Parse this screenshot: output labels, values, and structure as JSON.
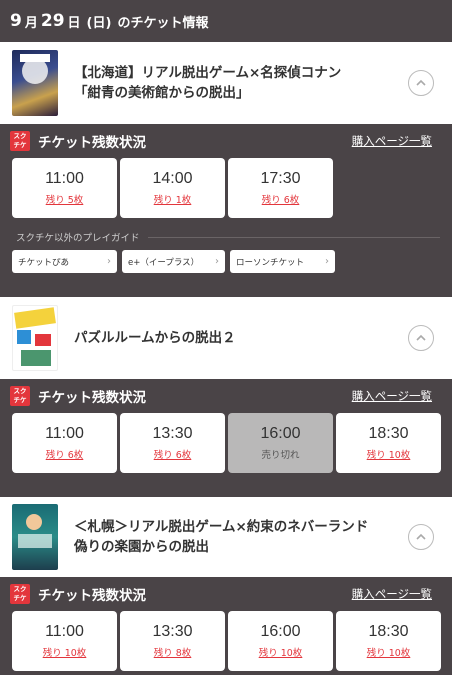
{
  "header": {
    "month": "9",
    "month_suffix": "月",
    "day": "29",
    "day_suffix": "日",
    "weekday": "(日)",
    "title_suffix": "のチケット情報"
  },
  "events": [
    {
      "title": "【北海道】リアル脱出ゲーム×名探偵コナン「紺青の美術館からの脱出」",
      "title_line1": "【北海道】リアル脱出ゲーム×名探偵コナン",
      "title_line2": "「紺青の美術館からの脱出」",
      "panel_title": "チケット残数状況",
      "buy_link": "購入ページ一覧",
      "slots": [
        {
          "time": "11:00",
          "remaining": "残り 5枚"
        },
        {
          "time": "14:00",
          "remaining": "残り 1枚"
        },
        {
          "time": "17:30",
          "remaining": "残り 6枚"
        }
      ],
      "other_label": "スクチケ以外のプレイガイド",
      "guides": [
        "チケットぴあ",
        "e+（イープラス）",
        "ローソンチケット"
      ]
    },
    {
      "title": "パズルルームからの脱出２",
      "panel_title": "チケット残数状況",
      "buy_link": "購入ページ一覧",
      "slots": [
        {
          "time": "11:00",
          "remaining": "残り 6枚"
        },
        {
          "time": "13:30",
          "remaining": "残り 6枚"
        },
        {
          "time": "16:00",
          "remaining": "売り切れ"
        },
        {
          "time": "18:30",
          "remaining": "残り 10枚"
        }
      ]
    },
    {
      "title_line1": "＜札幌＞リアル脱出ゲーム×約束のネバーランド",
      "title_line2": "偽りの楽園からの脱出",
      "panel_title": "チケット残数状況",
      "buy_link": "購入ページ一覧",
      "slots": [
        {
          "time": "11:00",
          "remaining": "残り 10枚"
        },
        {
          "time": "13:30",
          "remaining": "残り 8枚"
        },
        {
          "time": "16:00",
          "remaining": "残り 10枚"
        },
        {
          "time": "18:30",
          "remaining": "残り 10枚"
        }
      ]
    }
  ],
  "logo": {
    "line1": "スク",
    "line2": "チケ"
  },
  "colors": {
    "header_bg": "#4a4447",
    "accent": "#e3363c",
    "soldout_bg": "#b9b8b8"
  }
}
